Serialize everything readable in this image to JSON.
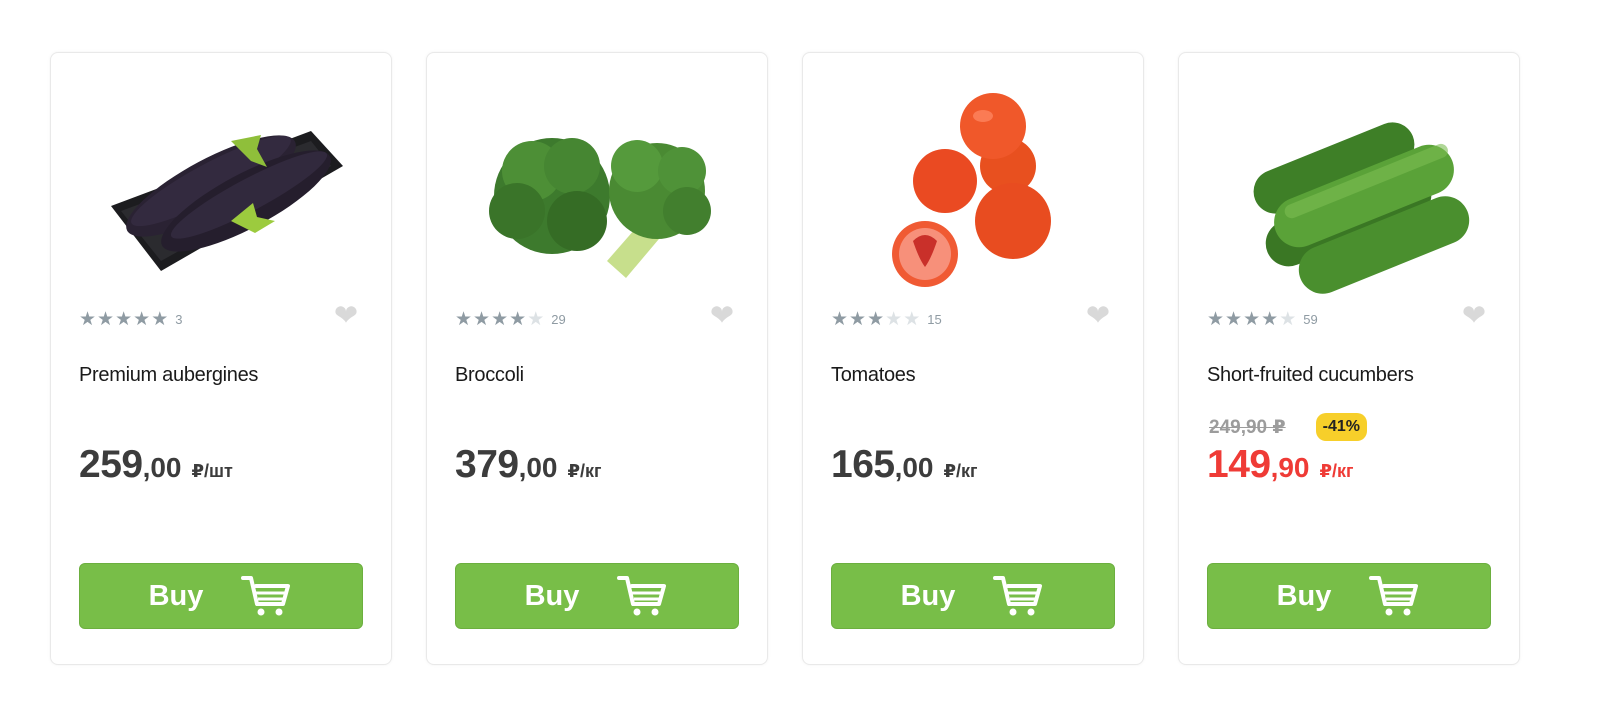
{
  "products": [
    {
      "name": "Premium aubergines",
      "image_icon": "aubergine-image",
      "rating": 5,
      "reviews": "3",
      "price_int": "259",
      "price_frac": ",00",
      "unit": "₽/шт",
      "buy_label": "Buy"
    },
    {
      "name": "Broccoli",
      "image_icon": "broccoli-image",
      "rating": 4,
      "reviews": "29",
      "price_int": "379",
      "price_frac": ",00",
      "unit": "₽/кг",
      "buy_label": "Buy"
    },
    {
      "name": "Tomatoes",
      "image_icon": "tomatoes-image",
      "rating": 3,
      "reviews": "15",
      "price_int": "165",
      "price_frac": ",00",
      "unit": "₽/кг",
      "buy_label": "Buy"
    },
    {
      "name": "Short-fruited cucumbers",
      "image_icon": "cucumbers-image",
      "rating": 4,
      "reviews": "59",
      "old_price": "249,90 ₽",
      "discount": "-41%",
      "price_int": "149",
      "price_frac": ",90",
      "unit": "₽/кг",
      "buy_label": "Buy"
    }
  ],
  "colors": {
    "buy_button": "#78be48",
    "sale_price": "#ef3b36",
    "discount_badge": "#f7cf2a",
    "star_on": "#8f9ba3",
    "star_off": "#dde2e5"
  },
  "icons": {
    "favorite": "heart-icon",
    "cart": "cart-icon",
    "rating": "star-icon"
  }
}
